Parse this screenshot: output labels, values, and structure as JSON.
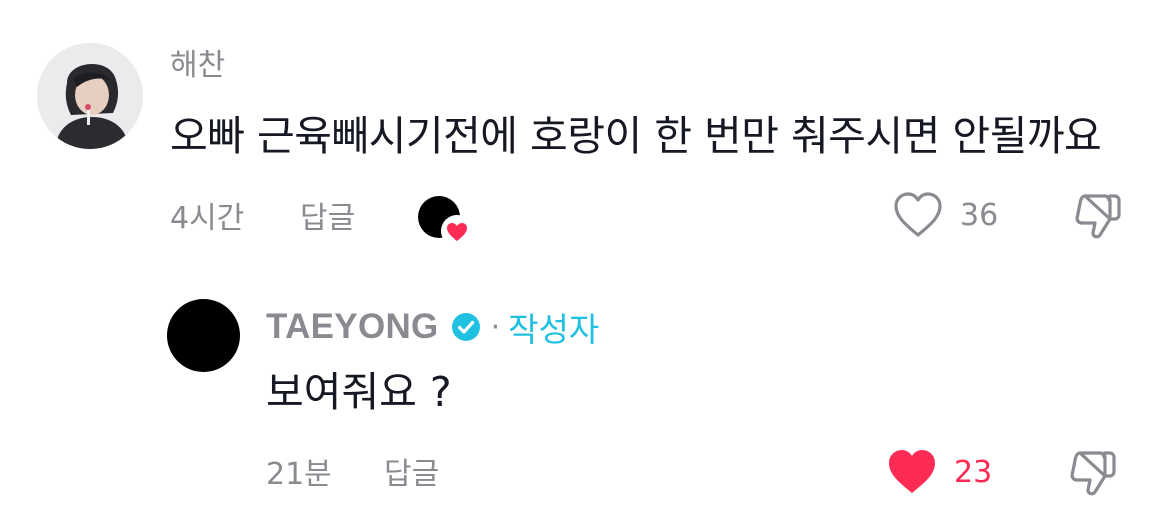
{
  "comment": {
    "username": "해찬",
    "text": "오빠 근육빼시기전에 호랑이 한 번만 춰주시면 안될까요",
    "time": "4시간",
    "reply_label": "답글",
    "like_count": "36",
    "liked": false,
    "creator_liked": true
  },
  "reply": {
    "username": "TAEYONG",
    "verified": true,
    "separator": "·",
    "creator_label": "작성자",
    "text": "보여줘요 ?",
    "time": "21분",
    "reply_label": "답글",
    "like_count": "23",
    "liked": true
  },
  "colors": {
    "like_active": "#fe2c55",
    "creator_tag": "#20c1e0",
    "secondary_text": "#8a8b91",
    "primary_text": "#161823"
  },
  "icons": {
    "like": "heart-outline-icon",
    "liked": "heart-filled-icon",
    "dislike": "thumbs-down-icon",
    "verified": "verified-badge-icon",
    "creator_liked": "creator-liked-heart-icon"
  }
}
